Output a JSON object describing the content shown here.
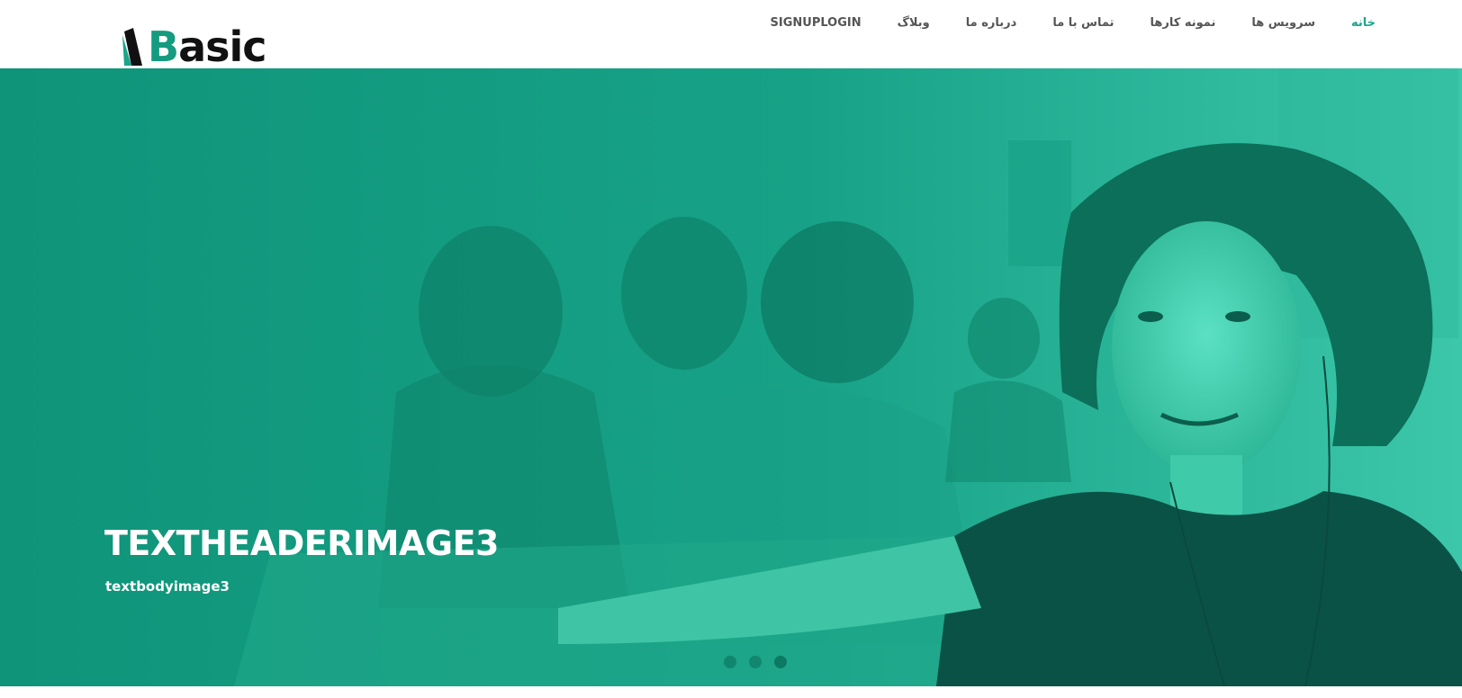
{
  "brand": {
    "name_initial": "B",
    "name_rest": "asic",
    "accent": "#159b80"
  },
  "nav": {
    "items": [
      {
        "label": "خانه",
        "active": true
      },
      {
        "label": "سرویس ها",
        "active": false
      },
      {
        "label": "نمونه کارها",
        "active": false
      },
      {
        "label": "تماس با ما",
        "active": false
      },
      {
        "label": "درباره ما",
        "active": false
      },
      {
        "label": "وبلاگ",
        "active": false
      },
      {
        "label": "SIGNUPLOGIN",
        "active": false
      }
    ]
  },
  "hero": {
    "title": "TEXTHEADERIMAGE3",
    "subtitle": "textbodyimage3",
    "overlay_color": "#159e83",
    "slides_total": 3,
    "active_slide": 3
  }
}
